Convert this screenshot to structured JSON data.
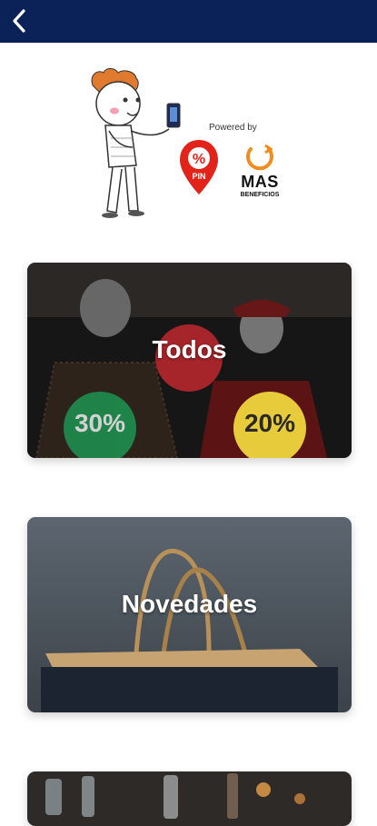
{
  "header": {
    "back_icon": "chevron-left-icon",
    "bg_color": "#0b2258"
  },
  "brand": {
    "powered_by": "Powered by",
    "pin_label": "PIN",
    "pin_badge": "%",
    "mas_name": "MAS",
    "mas_tagline": "BENEFICIOS"
  },
  "categories": [
    {
      "title": "Todos",
      "badges": [
        "30%",
        "20%"
      ],
      "badge_colors": [
        "#1f8a4c",
        "#f0d53d"
      ],
      "center_circle_color": "#b3272d"
    },
    {
      "title": "Novedades"
    },
    {
      "title": ""
    }
  ]
}
